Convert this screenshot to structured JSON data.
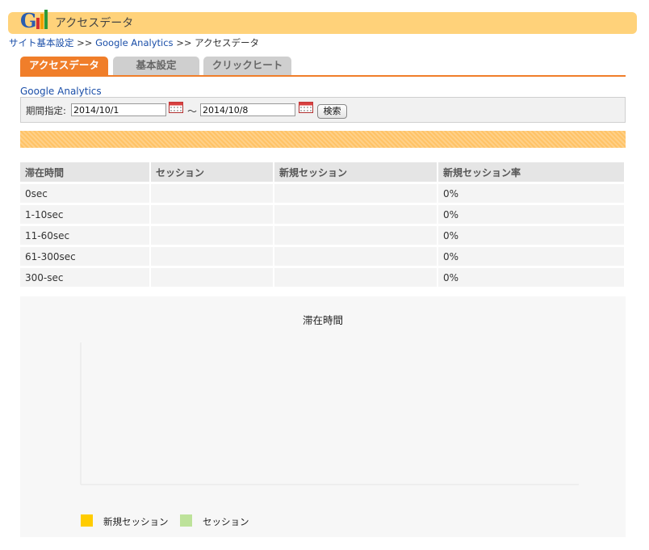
{
  "header": {
    "logo_text": "GA",
    "title": "アクセスデータ"
  },
  "breadcrumb": {
    "items": [
      "サイト基本設定",
      "Google Analytics",
      "アクセスデータ"
    ],
    "separator": ">>"
  },
  "tabs": [
    {
      "label": "アクセスデータ",
      "active": true
    },
    {
      "label": "基本設定",
      "active": false
    },
    {
      "label": "クリックヒート",
      "active": false
    }
  ],
  "ga_label": "Google Analytics",
  "filter": {
    "period_label": "期間指定:",
    "start_date": "2014/10/1",
    "end_date": "2014/10/8",
    "tilde": "〜",
    "search_label": "検索"
  },
  "table": {
    "headers": [
      "滞在時間",
      "セッション",
      "新規セッション",
      "新規セッション率"
    ],
    "rows": [
      [
        "0sec",
        "",
        "",
        "0%"
      ],
      [
        "1-10sec",
        "",
        "",
        "0%"
      ],
      [
        "11-60sec",
        "",
        "",
        "0%"
      ],
      [
        "61-300sec",
        "",
        "",
        "0%"
      ],
      [
        "300-sec",
        "",
        "",
        "0%"
      ]
    ]
  },
  "chart_data": {
    "type": "bar",
    "title": "滞在時間",
    "categories": [],
    "series": [
      {
        "name": "新規セッション",
        "color": "#ffcc00",
        "values": []
      },
      {
        "name": "セッション",
        "color": "#bde29a",
        "values": []
      }
    ],
    "legend_position": "bottom-left",
    "grid": false
  },
  "colors": {
    "accent": "#f07e2a",
    "header_bg": "#ffd27a",
    "band": "#ffc366",
    "link": "#1a4ea8"
  }
}
